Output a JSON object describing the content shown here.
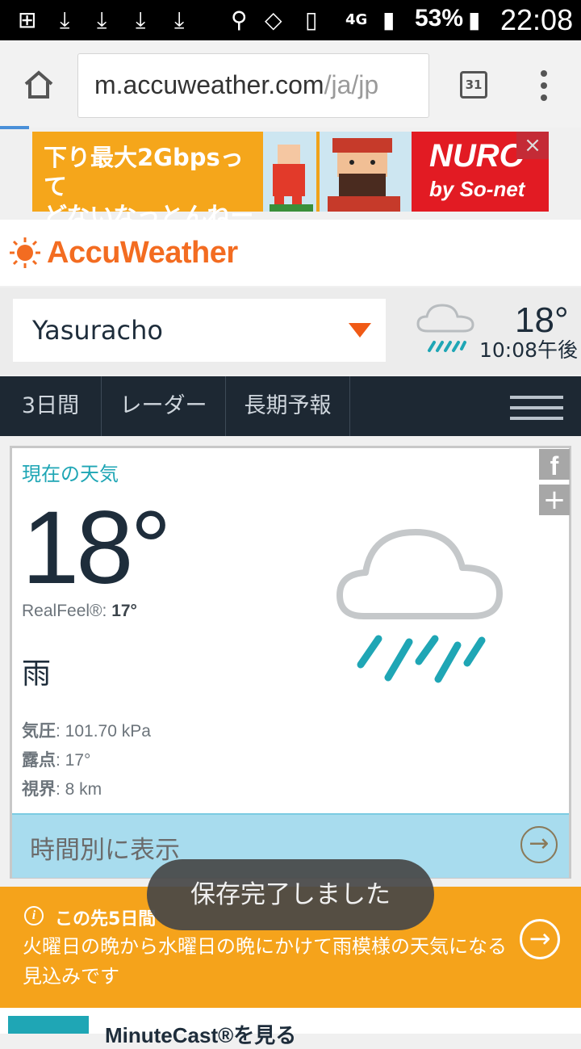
{
  "status_bar": {
    "network": "4G",
    "battery": "53%",
    "time": "22:08"
  },
  "browser": {
    "url_main": "m.accuweather.com",
    "url_path": "/ja/jp",
    "tabs_count": "31"
  },
  "ad": {
    "line1": "下り最大2Gbpsって",
    "line2": "どないなっとんねーん。",
    "brand": "NURO",
    "brand_sub": "by So-net",
    "close": "×"
  },
  "site": {
    "logo": "AccuWeather",
    "brand_color": "#f36c21"
  },
  "location": {
    "name": "Yasuracho",
    "header_temp": "18°",
    "header_time": "10:08午後"
  },
  "nav": {
    "tabs": [
      "3日間",
      "レーダー",
      "長期予報"
    ]
  },
  "current": {
    "title": "現在の天気",
    "temp": "18°",
    "realfeel_label": "RealFeel®: ",
    "realfeel_value": "17°",
    "condition": "雨",
    "pressure_label": "気圧",
    "pressure_value": ": 101.70 kPa",
    "dewpoint_label": "露点",
    "dewpoint_value": ": 17°",
    "visibility_label": "視界",
    "visibility_value": ": 8 km",
    "hourly_label": "時間別に表示",
    "icon": "rain-cloud-icon"
  },
  "banner": {
    "title": "この先5日間",
    "text": "火曜日の晩から水曜日の晩にかけて雨模様の天気になる見込みです"
  },
  "toast": {
    "text": "保存完了しました"
  },
  "bottom": {
    "text": "MinuteCast®を見る"
  }
}
